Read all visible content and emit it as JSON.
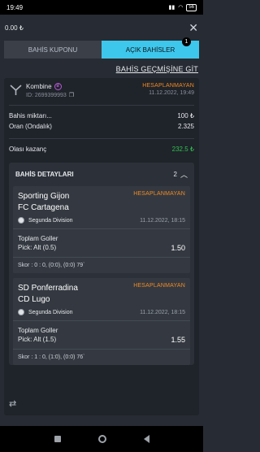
{
  "status_bar": {
    "time": "19:49",
    "battery": "56"
  },
  "header": {
    "balance": "0.00 ₺",
    "close_icon": "close-icon"
  },
  "tabs": [
    {
      "label": "BAHİS KUPONU"
    },
    {
      "label": "AÇIK BAHİSLER",
      "badge": "1"
    }
  ],
  "history_link": "BAHİS GEÇMİŞİNE GİT",
  "bet": {
    "type": "Kombine",
    "id": "ID: 2699399993",
    "status": "HESAPLANMAYAN",
    "date": "11.12.2022, 19:49",
    "amount_label": "Bahis miktarı...",
    "amount_value": "100 ₺",
    "odds_label": "Oran (Ondalık)",
    "odds_value": "2.325",
    "potential_label": "Olası kazanç",
    "potential_value": "232.5 ₺"
  },
  "details": {
    "title": "BAHİS DETAYLARI",
    "count": "2",
    "events": [
      {
        "home": "Sporting Gijon",
        "away": "FC Cartagena",
        "status": "HESAPLANMAYAN",
        "league": "Segunda Division",
        "date": "11.12.2022, 18:15",
        "market": "Toplam Goller",
        "pick": "Pick: Alt (0.5)",
        "odds": "1.50",
        "score": "Skor : 0 : 0, (0:0), (0:0) 79`"
      },
      {
        "home": "SD Ponferradina",
        "away": "CD Lugo",
        "status": "HESAPLANMAYAN",
        "league": "Segunda Division",
        "date": "11.12.2022, 18:15",
        "market": "Toplam Goller",
        "pick": "Pick: Alt (1.5)",
        "odds": "1.55",
        "score": "Skor : 1 : 0, (1:0), (0:0) 76`"
      }
    ]
  },
  "colors": {
    "accent": "#3ec7ec",
    "status_orange": "#f08a24",
    "win_green": "#2fc24f",
    "background": "#272b33"
  }
}
